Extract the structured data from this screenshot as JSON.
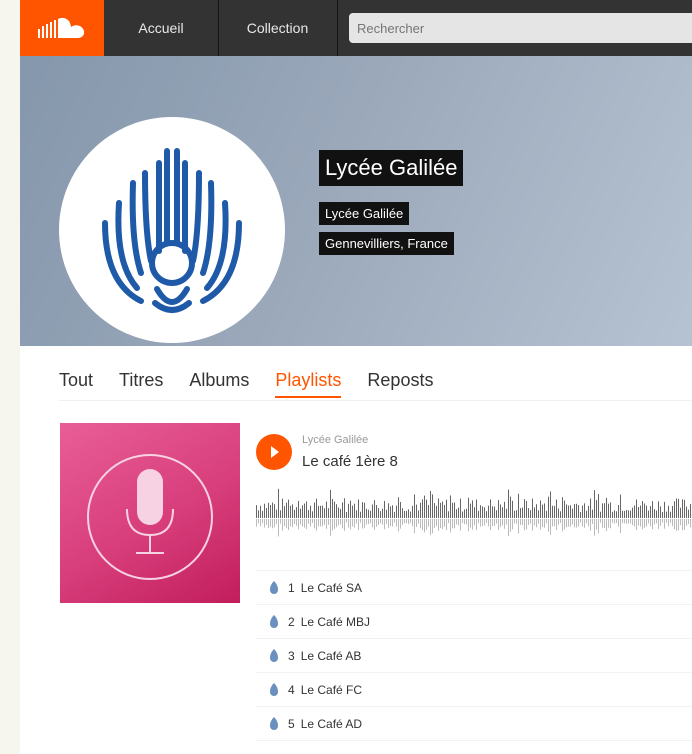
{
  "topbar": {
    "nav": [
      "Accueil",
      "Collection"
    ],
    "search_placeholder": "Rechercher",
    "logo_icon": "soundcloud-logo-icon"
  },
  "profile": {
    "name": "Lycée Galilée",
    "full_name": "Lycée Galilée",
    "location": "Gennevilliers, France",
    "avatar_icon": "lycee-galilee-logo"
  },
  "tabs": [
    "Tout",
    "Titres",
    "Albums",
    "Playlists",
    "Reposts"
  ],
  "active_tab": "Playlists",
  "playlist": {
    "user": "Lycée Galilée",
    "title": "Le café 1ère 8",
    "artwork_icon": "microphone-icon",
    "tracks": [
      {
        "num": "1",
        "title": "Le Café SA"
      },
      {
        "num": "2",
        "title": "Le Café MBJ"
      },
      {
        "num": "3",
        "title": "Le Café AB"
      },
      {
        "num": "4",
        "title": "Le Café FC"
      },
      {
        "num": "5",
        "title": "Le Café AD"
      }
    ]
  },
  "colors": {
    "accent": "#ff5500",
    "topbar": "#333333",
    "banner": "#9aa8ba",
    "artwork": "#d73e7b",
    "logo_blue": "#1f5aa8"
  }
}
